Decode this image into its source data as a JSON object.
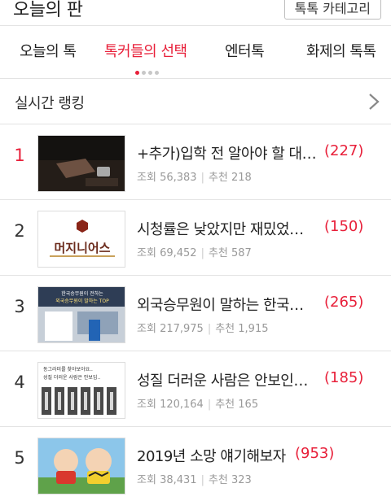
{
  "header": {
    "title": "오늘의 판",
    "category_button": "톡톡 카테고리"
  },
  "tabs": [
    {
      "label": "오늘의 톡",
      "active": false
    },
    {
      "label": "톡커들의 선택",
      "active": true
    },
    {
      "label": "엔터톡",
      "active": false
    },
    {
      "label": "화제의 톡톡",
      "active": false
    }
  ],
  "section": {
    "title": "실시간 랭킹"
  },
  "ranking": [
    {
      "rank": "1",
      "title": "+추가)입학 전 알아야 할 대…",
      "count": "(227)",
      "views_label": "조회",
      "views": "56,383",
      "recs_label": "추천",
      "recs": "218"
    },
    {
      "rank": "2",
      "title": "시청률은 낮았지만 재밌었…",
      "count": "(150)",
      "views_label": "조회",
      "views": "69,452",
      "recs_label": "추천",
      "recs": "587"
    },
    {
      "rank": "3",
      "title": "외국승무원이 말하는 한국…",
      "count": "(265)",
      "views_label": "조회",
      "views": "217,975",
      "recs_label": "추천",
      "recs": "1,915"
    },
    {
      "rank": "4",
      "title": "성질 더러운 사람은 안보인…",
      "count": "(185)",
      "views_label": "조회",
      "views": "120,164",
      "recs_label": "추천",
      "recs": "165"
    },
    {
      "rank": "5",
      "title": "2019년 소망 얘기해보자",
      "count": "(953)",
      "views_label": "조회",
      "views": "38,431",
      "recs_label": "추천",
      "recs": "323"
    }
  ],
  "thumbnails": {
    "t2_logo": "머지니어스",
    "t3_caption_1": "한국승무원이 전하는",
    "t3_caption_2": "외국승무원이 말하는 TOP",
    "t4_caption_1": "동그라미를 찾아보아요..",
    "t4_caption_2": "성질 더러운 사람은 안보임.."
  },
  "colors": {
    "accent": "#e8203a",
    "divider": "#e3e3e3",
    "muted": "#999999"
  }
}
